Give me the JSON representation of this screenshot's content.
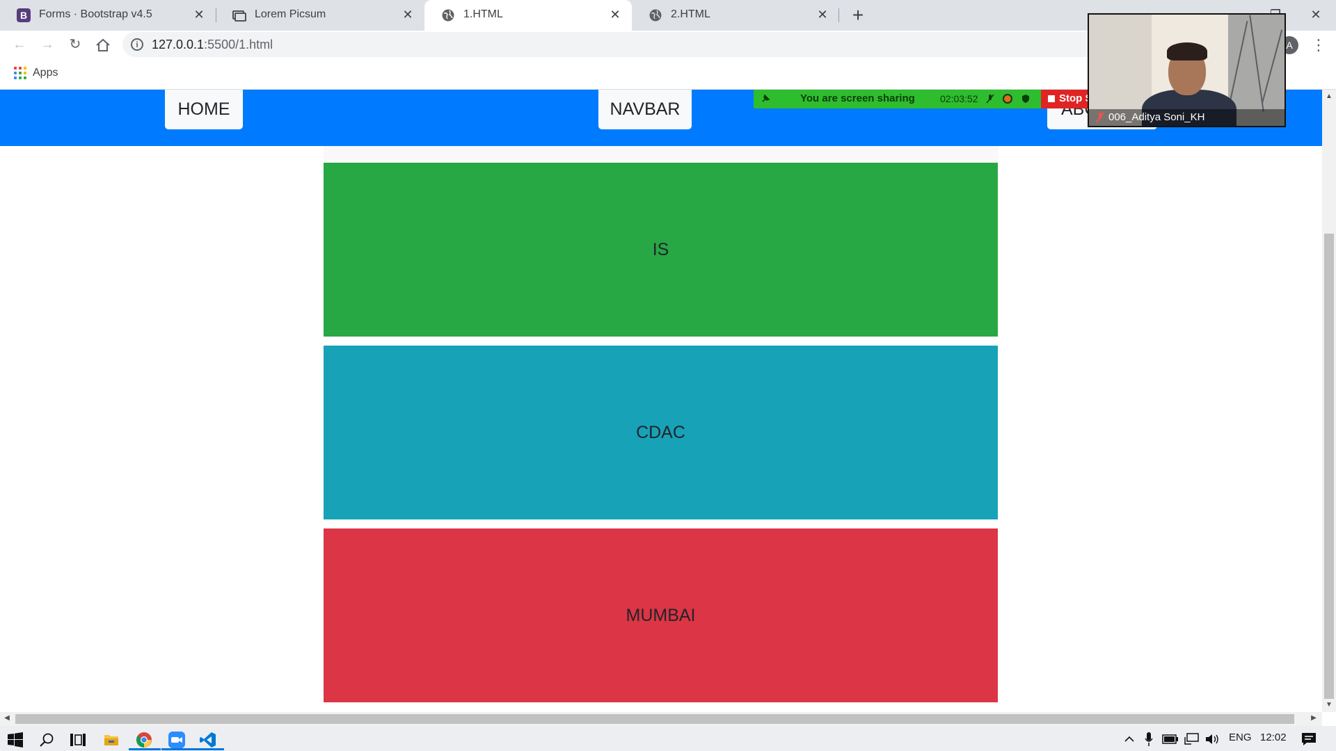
{
  "browser": {
    "tabs": [
      {
        "title": "Forms · Bootstrap v4.5",
        "icon": "bootstrap-icon",
        "active": false
      },
      {
        "title": "Lorem Picsum",
        "icon": "picsum-icon",
        "active": false
      },
      {
        "title": "1.HTML",
        "icon": "globe-icon",
        "active": true
      },
      {
        "title": "2.HTML",
        "icon": "globe-icon",
        "active": false
      }
    ],
    "url_host": "127.0.0.1",
    "url_rest": ":5500/1.html",
    "profile_initial": "A",
    "bookmarks": [
      {
        "label": "Apps",
        "icon": "apps-grid-icon"
      }
    ]
  },
  "page": {
    "navbar": {
      "home_label": "HOME",
      "navbar_label": "NAVBAR",
      "about_label": "ABC"
    },
    "blocks": [
      {
        "label": "IS",
        "color": "#28a745"
      },
      {
        "label": "CDAC",
        "color": "#17a2b8"
      },
      {
        "label": "MUMBAI",
        "color": "#dc3545"
      }
    ]
  },
  "zoom": {
    "share_text": "You are screen sharing",
    "share_time": "02:03:52",
    "stop_label": "Stop S",
    "participant_name": "006_Aditya Soni_KH"
  },
  "taskbar": {
    "language": "ENG",
    "time": "12:02"
  },
  "colors": {
    "navbar": "#007bff",
    "share_bar": "#2ebd2e",
    "stop_button": "#e02424"
  }
}
